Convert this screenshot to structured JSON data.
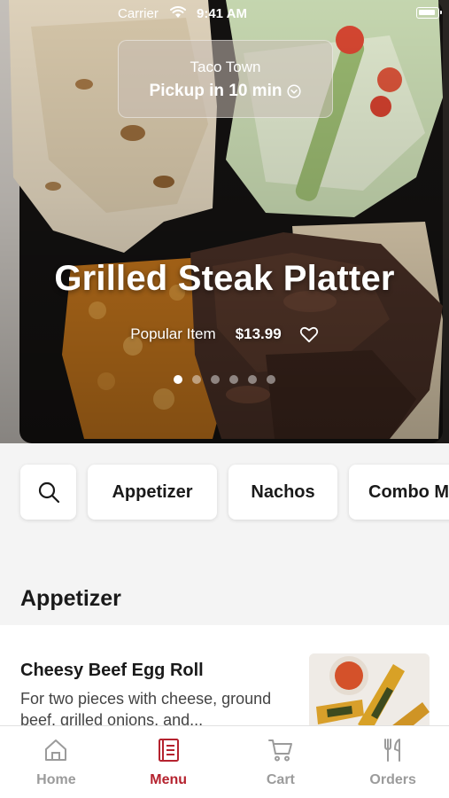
{
  "status_bar": {
    "carrier": "Carrier",
    "time": "9:41 AM"
  },
  "pickup": {
    "store": "Taco Town",
    "time": "Pickup in 10 min"
  },
  "hero": {
    "title": "Grilled Steak Platter",
    "badge": "Popular Item",
    "price": "$13.99",
    "active_slide": 1,
    "slide_count": 6
  },
  "categories": [
    "Appetizer",
    "Nachos",
    "Combo M"
  ],
  "section_title": "Appetizer",
  "menu_item": {
    "name": "Cheesy Beef Egg Roll",
    "description": "For two pieces with cheese, ground beef, grilled onions, and..."
  },
  "tabs": [
    {
      "label": "Home",
      "icon": "home-icon"
    },
    {
      "label": "Menu",
      "icon": "menu-book-icon"
    },
    {
      "label": "Cart",
      "icon": "cart-icon"
    },
    {
      "label": "Orders",
      "icon": "fork-knife-icon"
    }
  ],
  "colors": {
    "accent": "#b5232f",
    "inactive_tab": "#9b9b9b",
    "text": "#1a1a1a"
  }
}
